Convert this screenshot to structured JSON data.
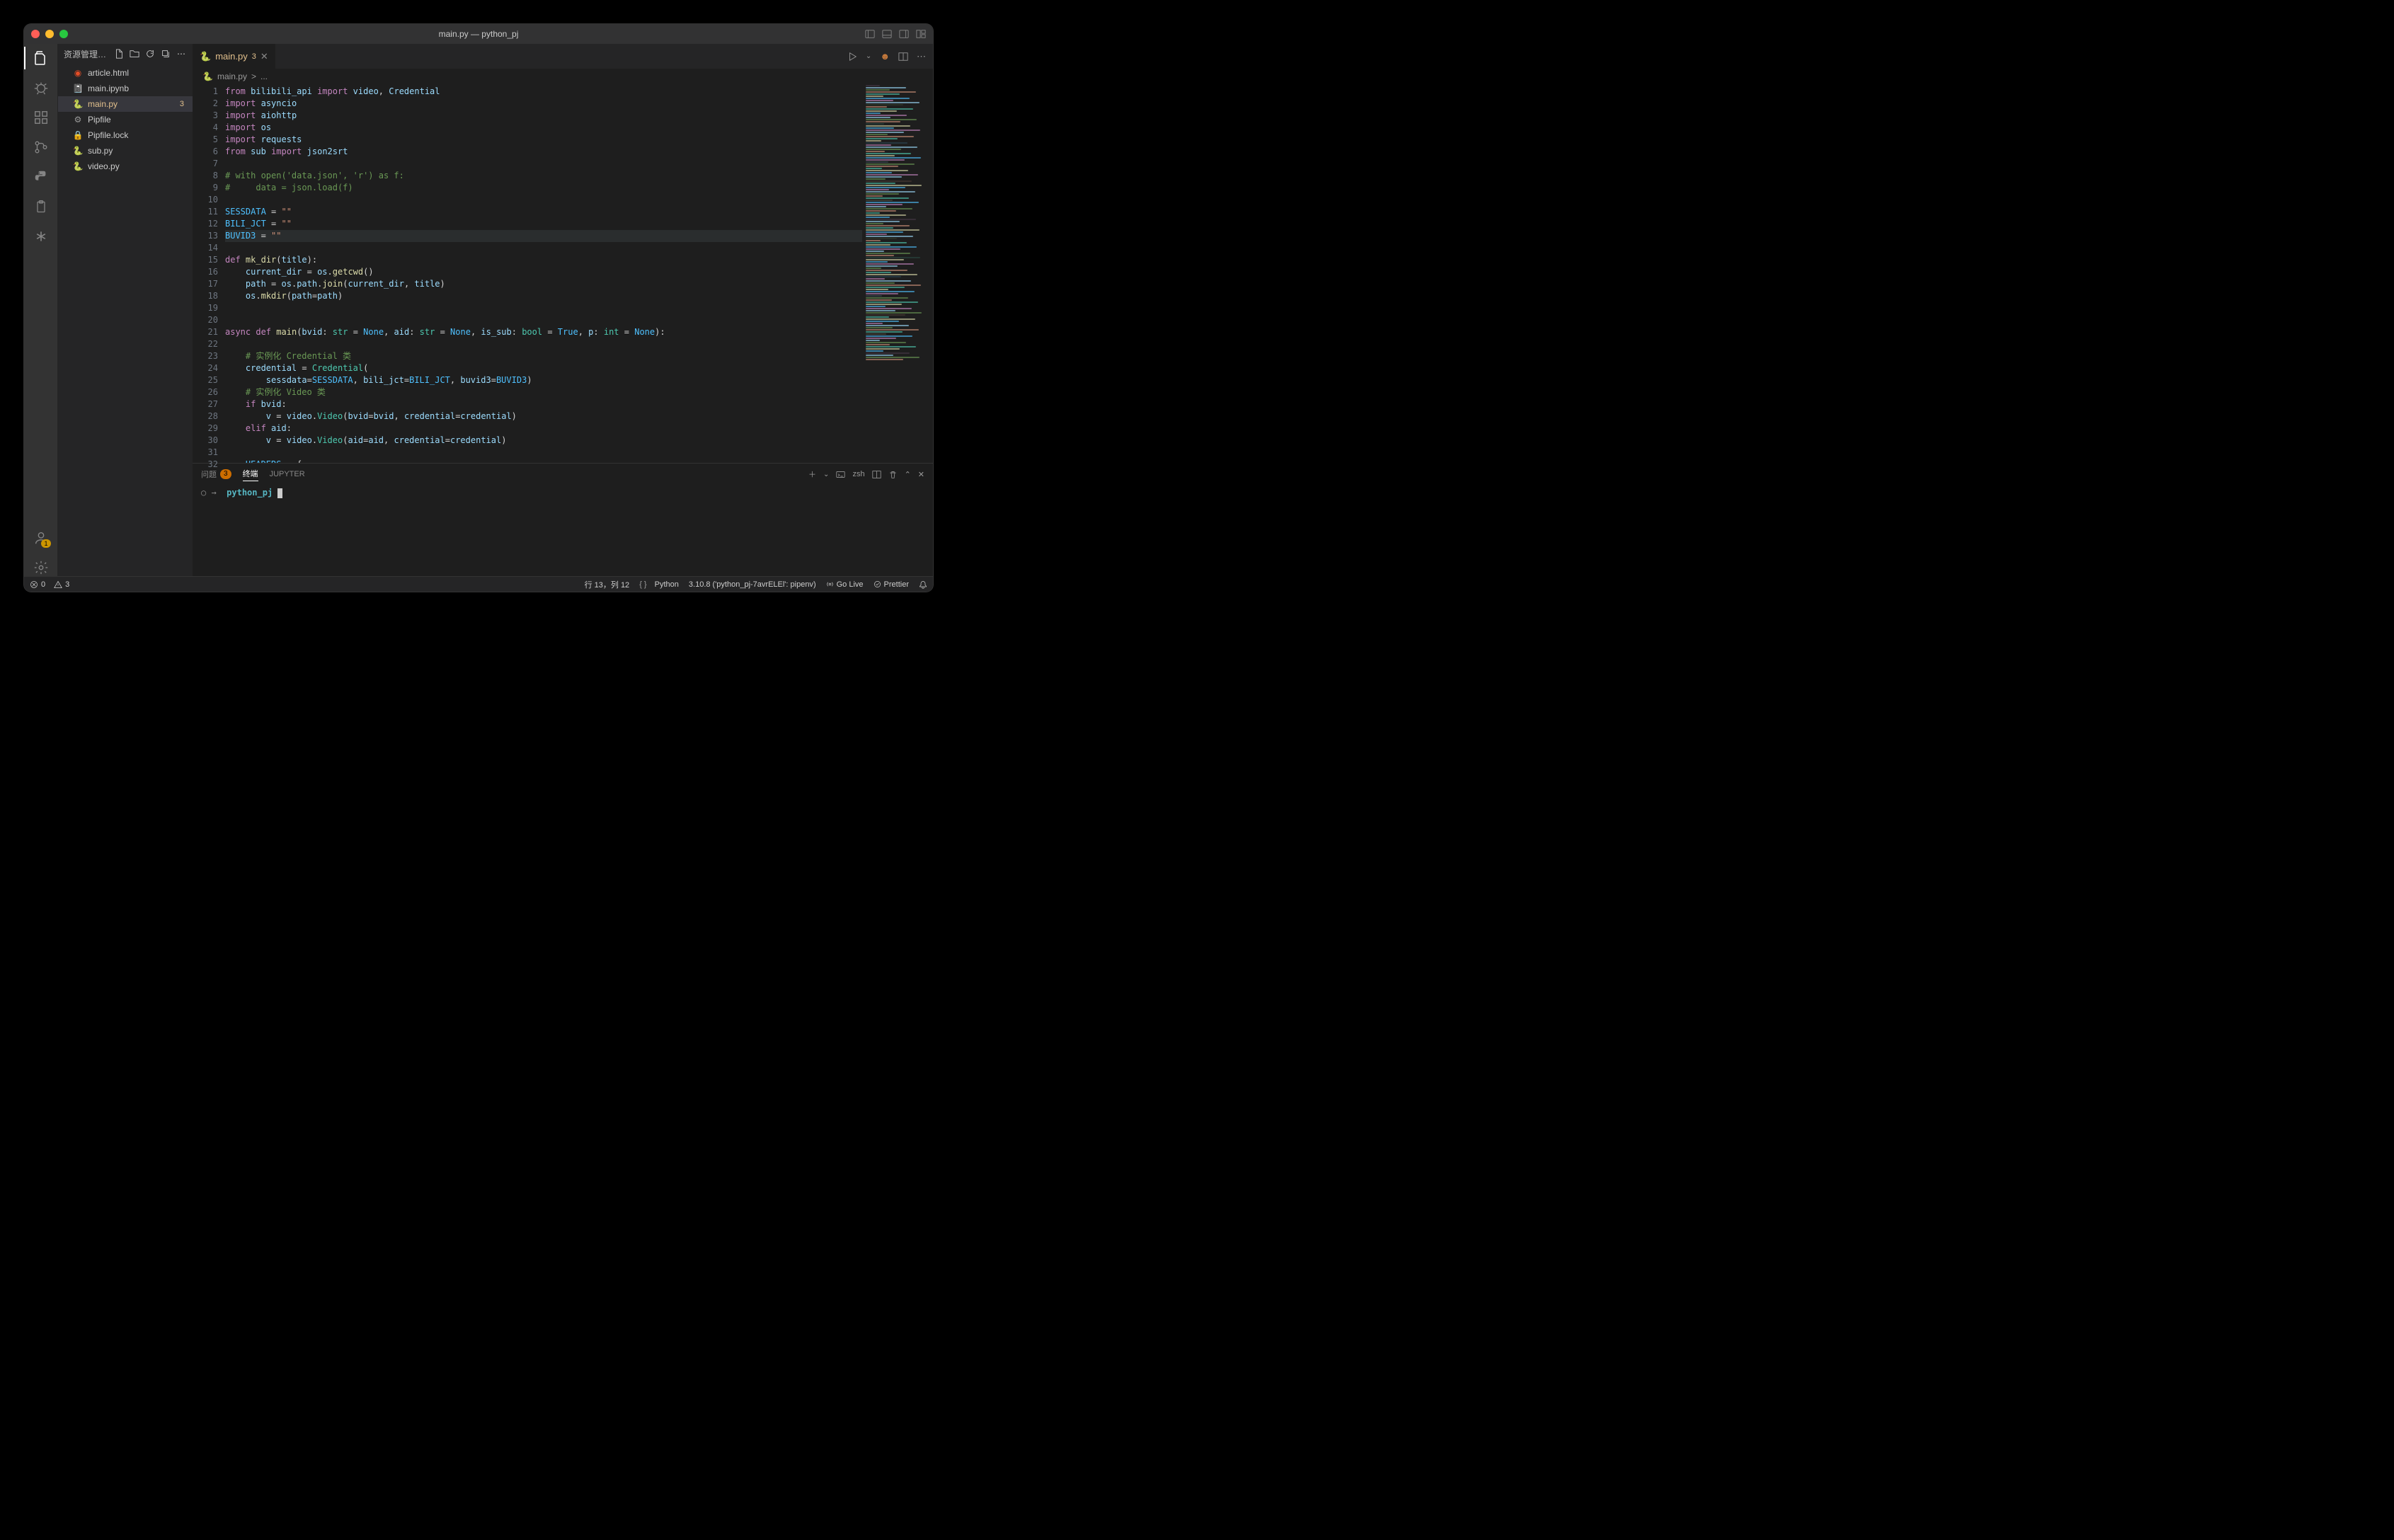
{
  "title": "main.py — python_pj",
  "sidebar": {
    "header_label": "资源管理器: P...",
    "files": [
      {
        "name": "article.html",
        "icon": "html"
      },
      {
        "name": "main.ipynb",
        "icon": "notebook"
      },
      {
        "name": "main.py",
        "icon": "python",
        "modified": true,
        "badge": "3"
      },
      {
        "name": "Pipfile",
        "icon": "pipfile"
      },
      {
        "name": "Pipfile.lock",
        "icon": "lock"
      },
      {
        "name": "sub.py",
        "icon": "python"
      },
      {
        "name": "video.py",
        "icon": "python"
      }
    ]
  },
  "tab": {
    "name": "main.py",
    "badge": "3"
  },
  "breadcrumb": {
    "file": "main.py",
    "sep": ">",
    "symbol": "..."
  },
  "code_lines": [
    "<span class='kw'>from</span> <span class='var'>bilibili_api</span> <span class='kw'>import</span> <span class='var'>video</span>, <span class='var'>Credential</span>",
    "<span class='kw'>import</span> <span class='var'>asyncio</span>",
    "<span class='kw'>import</span> <span class='var'>aiohttp</span>",
    "<span class='kw'>import</span> <span class='var'>os</span>",
    "<span class='kw'>import</span> <span class='var'>requests</span>",
    "<span class='kw'>from</span> <span class='var'>sub</span> <span class='kw'>import</span> <span class='var'>json2srt</span>",
    "",
    "<span class='cm'># with open('data.json', 'r') as f:</span>",
    "<span class='cm'>#     data = json.load(f)</span>",
    "",
    "<span class='const'>SESSDATA</span> = <span class='str'>\"\"</span>",
    "<span class='const'>BILI_JCT</span> = <span class='str'>\"\"</span>",
    "<span class='const'>BUVID3</span> = <span class='str'>\"\"</span>",
    "",
    "<span class='kw'>def</span> <span class='fn'>mk_dir</span>(<span class='var'>title</span>):",
    "    <span class='var'>current_dir</span> = <span class='var'>os</span>.<span class='fn'>getcwd</span>()",
    "    <span class='var'>path</span> = <span class='var'>os</span>.<span class='var'>path</span>.<span class='fn'>join</span>(<span class='var'>current_dir</span>, <span class='var'>title</span>)",
    "    <span class='var'>os</span>.<span class='fn'>mkdir</span>(<span class='var'>path</span>=<span class='var'>path</span>)",
    "",
    "",
    "<span class='kw'>async</span> <span class='kw'>def</span> <span class='fn'>main</span>(<span class='var'>bvid</span>: <span class='cls'>str</span> = <span class='const'>None</span>, <span class='var'>aid</span>: <span class='cls'>str</span> = <span class='const'>None</span>, <span class='var'>is_sub</span>: <span class='cls'>bool</span> = <span class='const'>True</span>, <span class='var'>p</span>: <span class='cls'>int</span> = <span class='const'>None</span>):",
    "",
    "    <span class='cm'># 实例化 Credential 类</span>",
    "    <span class='var'>credential</span> = <span class='cls'>Credential</span>(",
    "        <span class='var'>sessdata</span>=<span class='const'>SESSDATA</span>, <span class='var'>bili_jct</span>=<span class='const'>BILI_JCT</span>, <span class='var'>buvid3</span>=<span class='const'>BUVID3</span>)",
    "    <span class='cm'># 实例化 Video 类</span>",
    "    <span class='kw'>if</span> <span class='var'>bvid</span>:",
    "        <span class='var'>v</span> = <span class='var'>video</span>.<span class='cls'>Video</span>(<span class='var'>bvid</span>=<span class='var'>bvid</span>, <span class='var'>credential</span>=<span class='var'>credential</span>)",
    "    <span class='kw'>elif</span> <span class='var'>aid</span>:",
    "        <span class='var'>v</span> = <span class='var'>video</span>.<span class='cls'>Video</span>(<span class='var'>aid</span>=<span class='var'>aid</span>, <span class='var'>credential</span>=<span class='var'>credential</span>)",
    "",
    "    <span class='const'>HEADERS</span> = {"
  ],
  "highlight_line": 13,
  "panel": {
    "tabs": {
      "problems": "问题",
      "problems_badge": "3",
      "terminal": "终端",
      "jupyter": "JUPYTER"
    },
    "shell_label": "zsh",
    "terminal": {
      "prompt_symbol": "○ →",
      "dir": "python_pj"
    }
  },
  "status": {
    "errors": "0",
    "warnings": "3",
    "cursor": "行 13，列 12",
    "lang": "Python",
    "interpreter": "3.10.8 ('python_pj-7avrELEl': pipenv)",
    "golive": "Go Live",
    "prettier": "Prettier"
  },
  "accounts_badge": "1"
}
